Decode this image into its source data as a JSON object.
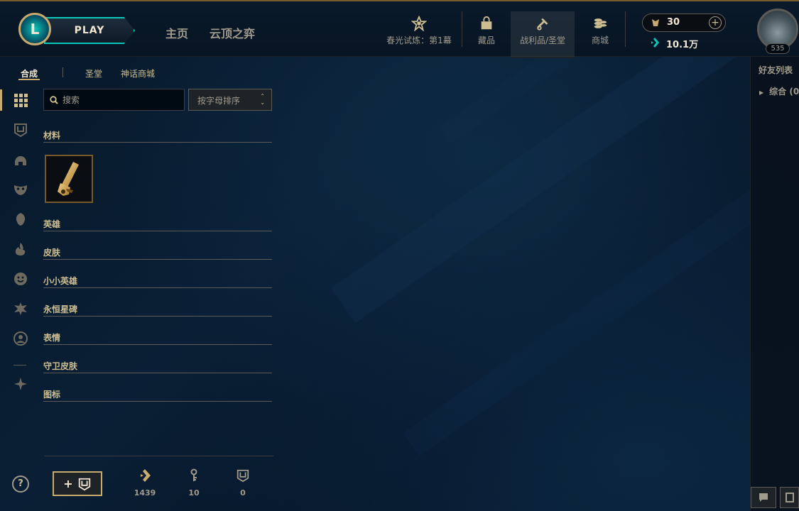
{
  "topbar": {
    "play_label": "PLAY",
    "nav": [
      {
        "label": "主页"
      },
      {
        "label": "云顶之弈"
      }
    ],
    "icons": [
      {
        "label": "春光试炼：第1幕",
        "icon": "event-pass-icon"
      },
      {
        "label": "藏品",
        "icon": "collection-bag-icon"
      },
      {
        "label": "战利品/圣堂",
        "icon": "loot-icon"
      },
      {
        "label": "商城",
        "icon": "store-coins-icon"
      }
    ],
    "rp_value": "30",
    "be_value": "10.1万",
    "level": "535"
  },
  "subtabs": [
    {
      "label": "合成"
    },
    {
      "label": "圣堂"
    },
    {
      "label": "神话商城"
    }
  ],
  "search": {
    "placeholder": "搜索"
  },
  "sort": {
    "label": "按字母排序"
  },
  "categories": [
    {
      "label": "材料"
    },
    {
      "label": "英雄"
    },
    {
      "label": "皮肤"
    },
    {
      "label": "小小英雄"
    },
    {
      "label": "永恒星碑"
    },
    {
      "label": "表情"
    },
    {
      "label": "守卫皮肤"
    },
    {
      "label": "图标"
    }
  ],
  "rail": [
    "grid-icon",
    "chest-icon",
    "helmet-icon",
    "mask-icon",
    "champion-head-icon",
    "flame-icon",
    "smiley-icon",
    "ward-icon",
    "profile-icon",
    "ornament-icon"
  ],
  "counters": [
    {
      "icon": "essence-icon",
      "value": "1439"
    },
    {
      "icon": "key-icon",
      "value": "10"
    },
    {
      "icon": "chest-icon",
      "value": "0"
    }
  ],
  "help_label": "?",
  "friends": {
    "title": "好友列表",
    "group": "综合 (0"
  },
  "colors": {
    "gold": "#c8aa6e",
    "teal": "#0ac8b9",
    "background": "#010a13"
  }
}
